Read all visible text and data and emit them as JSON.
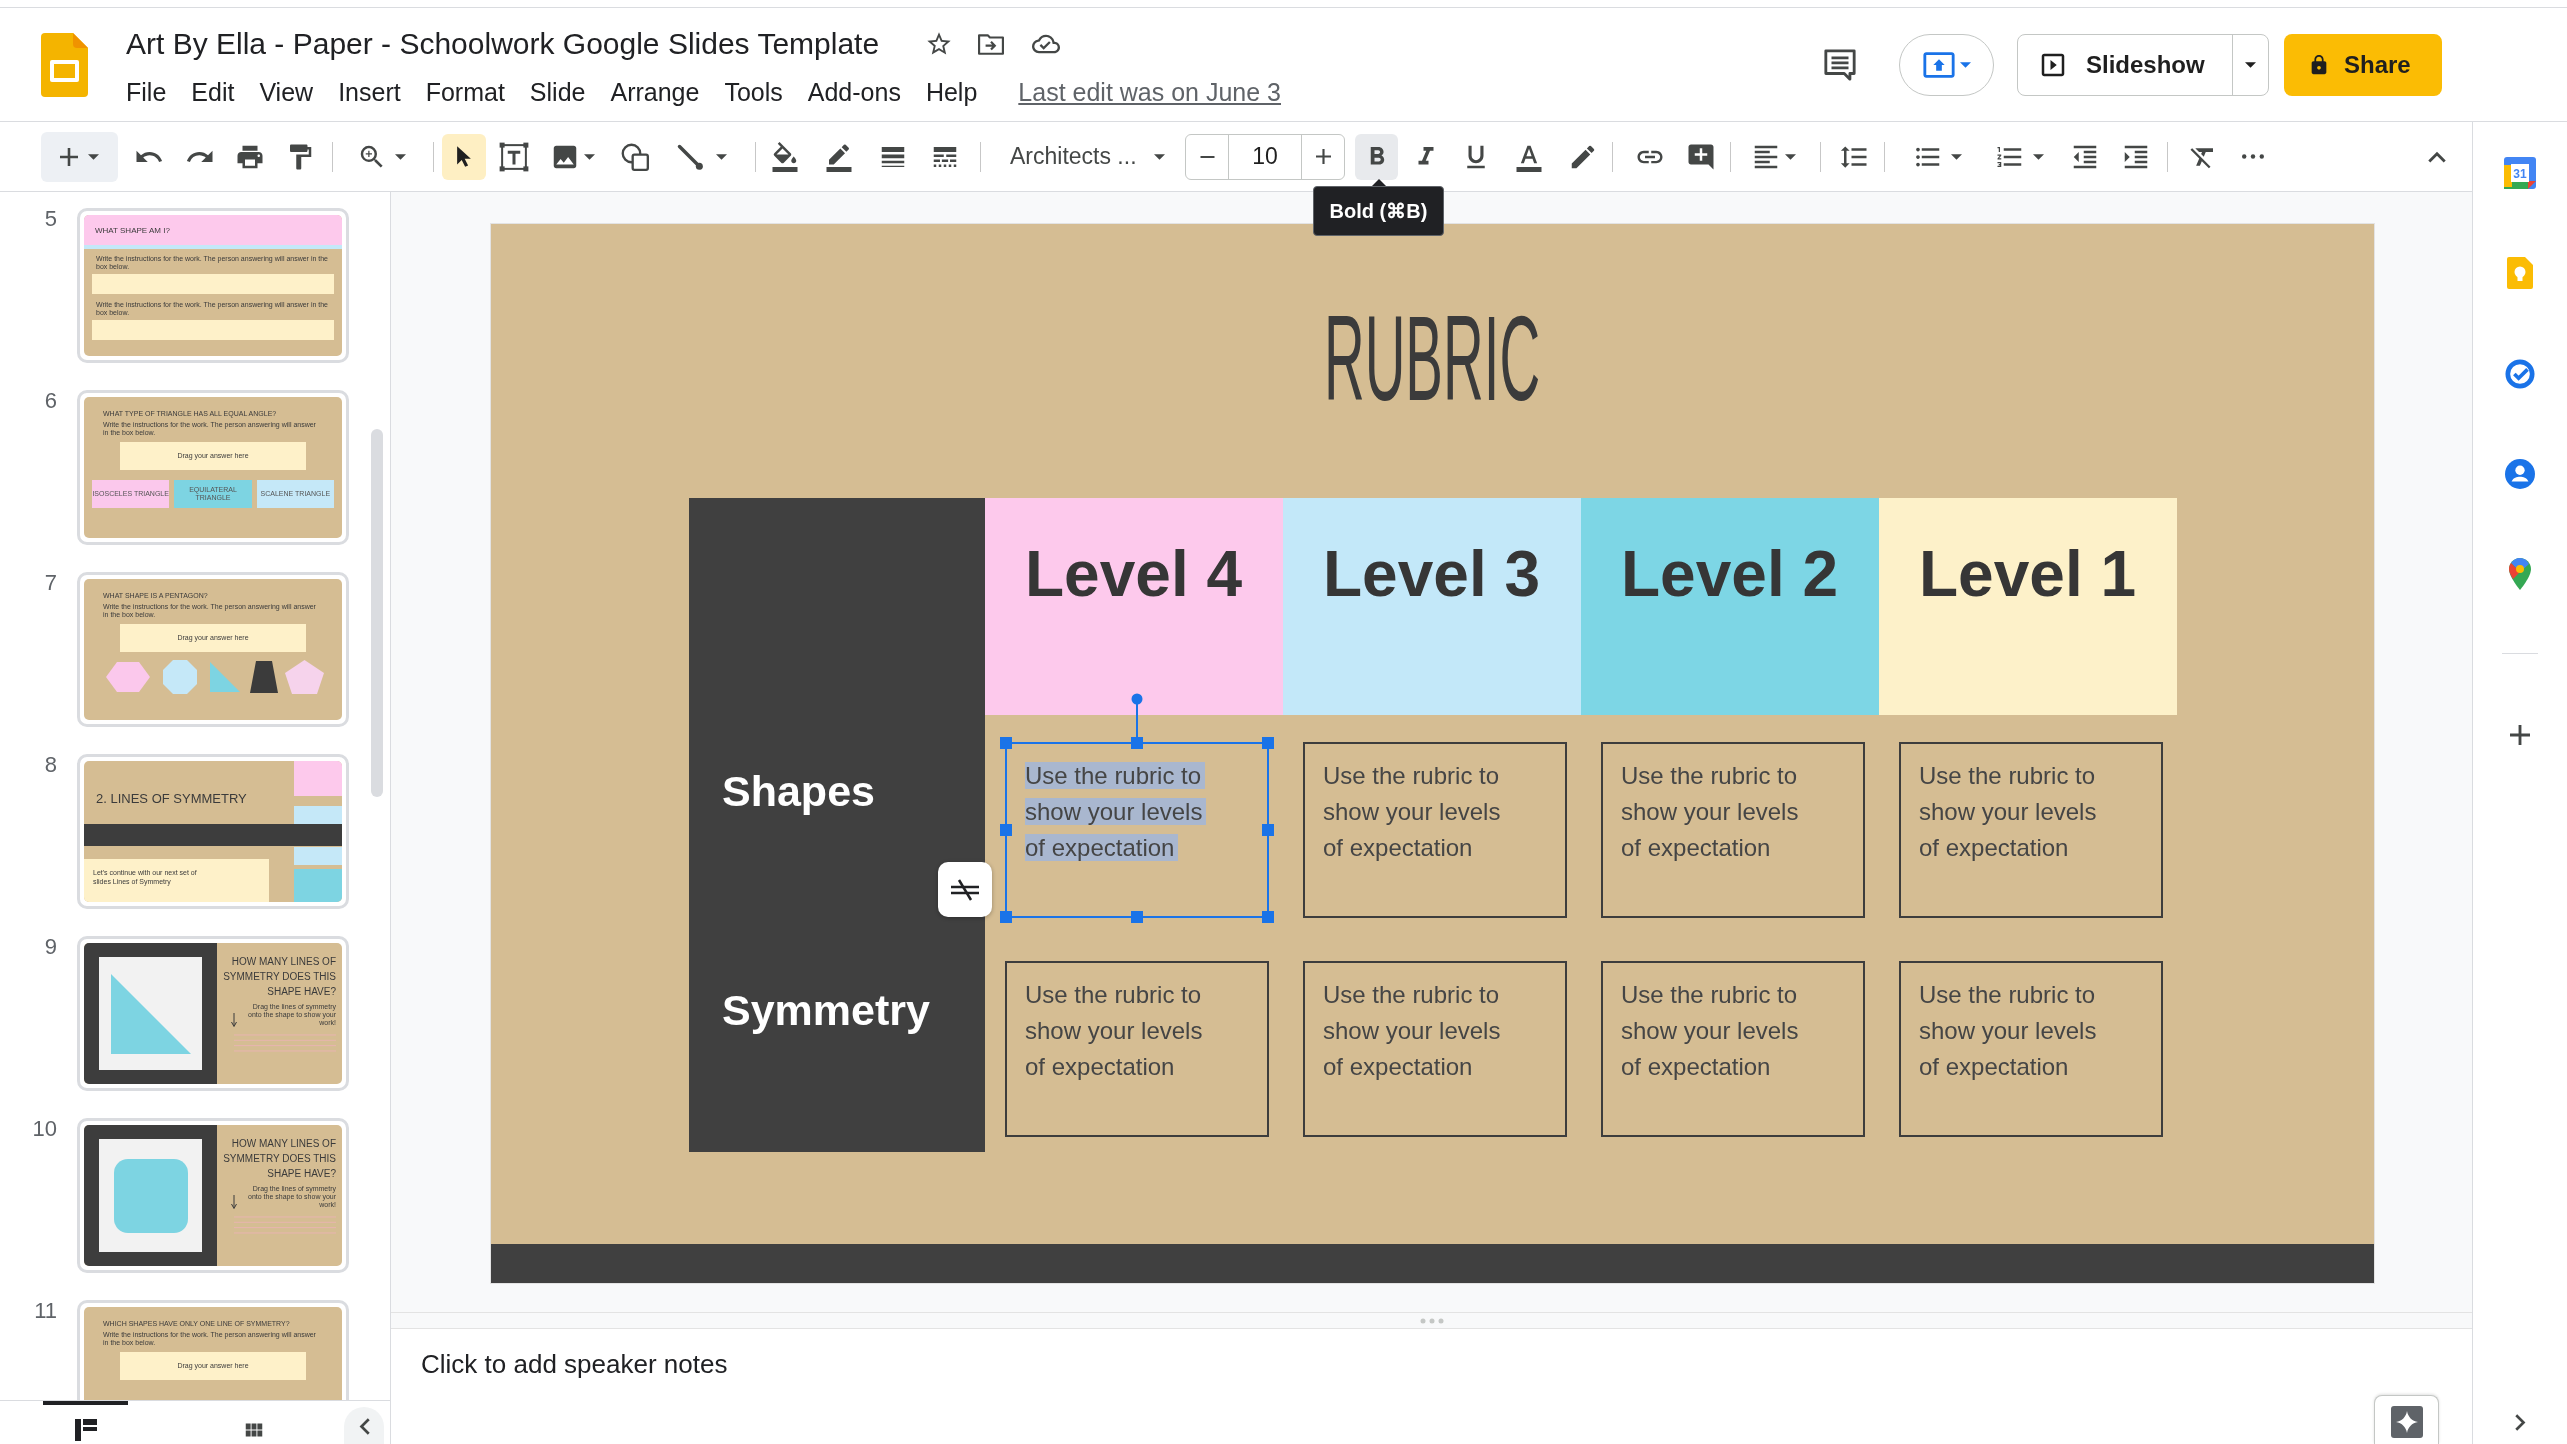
{
  "header": {
    "title": "Art By Ella - Paper - Schoolwork Google Slides Template",
    "menu": [
      "File",
      "Edit",
      "View",
      "Insert",
      "Format",
      "Slide",
      "Arrange",
      "Tools",
      "Add-ons",
      "Help"
    ],
    "last_edit": "Last edit was on June 3",
    "slideshow_button": "Slideshow",
    "share_button": "Share"
  },
  "toolbar": {
    "tools": [
      {
        "kind": "select",
        "selected": true
      },
      {
        "kind": "text_box",
        "selected": false
      },
      {
        "kind": "image",
        "selected": false
      },
      {
        "kind": "shape",
        "selected": false
      },
      {
        "kind": "line",
        "selected": false
      }
    ],
    "font": "Architects ...",
    "font_size": "10",
    "bold_button": {
      "hovered": true
    },
    "tooltip": "Bold (⌘B)"
  },
  "filmstrip": {
    "slides": [
      {
        "number": "5",
        "kind": "two_answers",
        "selected": false,
        "title": "WHAT SHAPE AM I?",
        "instructions": [
          "Write the instructions for the work. The person answering will answer in the box below.",
          "Write the instructions for the work. The person answering will answer in the box below."
        ]
      },
      {
        "number": "6",
        "kind": "drag_options",
        "selected": false,
        "title": "WHAT TYPE OF TRIANGLE HAS ALL EQUAL ANGLE?",
        "instruction": "Write the instructions for the work. The person answering will answer in the box below.",
        "answer_box": "Drag your answer here",
        "options": [
          {
            "label": "ISOSCELES TRIANGLE",
            "color": "#fbc8ec"
          },
          {
            "label": "EQUILATERAL TRIANGLE",
            "color": "#7dd4e2"
          },
          {
            "label": "SCALENE TRIANGLE",
            "color": "#c5e8f8"
          }
        ]
      },
      {
        "number": "7",
        "kind": "drag_shapes",
        "selected": false,
        "title": "WHAT SHAPE IS A PENTAGON?",
        "instruction": "Write the instructions for the work. The person answering will answer in the box below.",
        "answer_box": "Drag your answer here"
      },
      {
        "number": "8",
        "kind": "section",
        "selected": false,
        "title": "2. LINES OF SYMMETRY",
        "body": "Let's continue with our next set of slides Lines of Symmetry"
      },
      {
        "number": "9",
        "kind": "symmetry_triangle",
        "selected": false,
        "title": "HOW MANY LINES OF SYMMETRY DOES THIS SHAPE HAVE?",
        "body": "Drag the lines of symmetry onto the shape to show your work!"
      },
      {
        "number": "10",
        "kind": "symmetry_square",
        "selected": false,
        "title": "HOW MANY LINES OF SYMMETRY DOES THIS SHAPE HAVE?",
        "body": "Drag the lines of symmetry onto the shape to show your work!"
      },
      {
        "number": "11",
        "kind": "drag_answer",
        "selected": false,
        "title": "WHICH SHAPES HAVE ONLY ONE LINE OF SYMMETRY?",
        "instruction": "Write the instructions for the work. The person answering will answer in the box below.",
        "answer_box": "Drag your answer here"
      }
    ],
    "view_tabs": [
      {
        "kind": "filmstrip",
        "selected": true
      },
      {
        "kind": "grid",
        "selected": false
      }
    ]
  },
  "slide": {
    "title": "RUBRIC",
    "levels": [
      {
        "label": "Level 4",
        "color": "#fdc9ec"
      },
      {
        "label": "Level 3",
        "color": "#c3e8f9"
      },
      {
        "label": "Level 2",
        "color": "#7dd6e5"
      },
      {
        "label": "Level 1",
        "color": "#fdf1c9"
      }
    ],
    "rows": [
      {
        "label": "Shapes",
        "cells": [
          {
            "text": "Use the rubric to show your levels of expectation",
            "selected": true
          },
          {
            "text": "Use the rubric to show your levels of expectation",
            "selected": false
          },
          {
            "text": "Use the rubric to show your levels of expectation",
            "selected": false
          },
          {
            "text": "Use the rubric to show your levels of expectation",
            "selected": false
          }
        ]
      },
      {
        "label": "Symmetry",
        "cells": [
          {
            "text": "Use the rubric to show your levels of expectation",
            "selected": false
          },
          {
            "text": "Use the rubric to show your levels of expectation",
            "selected": false
          },
          {
            "text": "Use the rubric to show your levels of expectation",
            "selected": false
          },
          {
            "text": "Use the rubric to show your levels of expectation",
            "selected": false
          }
        ]
      }
    ]
  },
  "speaker_notes": {
    "placeholder": "Click to add speaker notes"
  },
  "side_panel": {
    "calendar_day": "31"
  }
}
